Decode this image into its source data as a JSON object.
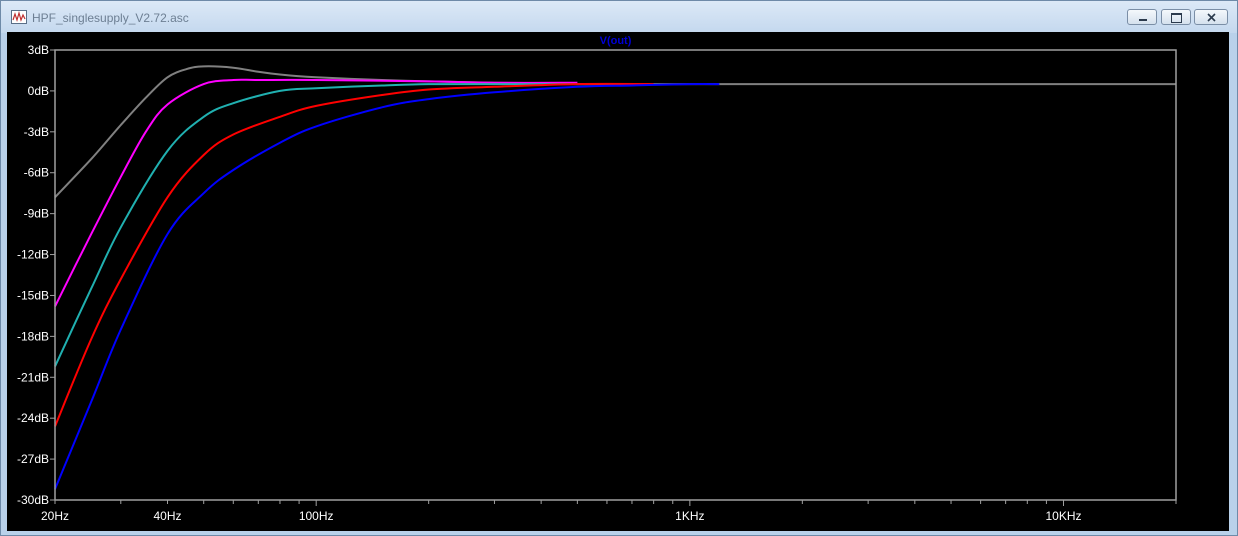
{
  "window": {
    "title": "HPF_singlesupply_V2.72.asc",
    "app_icon": "ltspice-waveform-icon",
    "controls": {
      "minimize": "minimize-icon",
      "maximize": "maximize-icon",
      "close": "close-icon"
    }
  },
  "chart_data": {
    "type": "line",
    "title": "V(out)",
    "title_color": "#0000d8",
    "background": "#000000",
    "axis_color": "#a0a0a0",
    "label_color": "#ffffff",
    "x_scale": "log",
    "xlim": [
      20,
      20000
    ],
    "ylim": [
      -30,
      3
    ],
    "x_ticks": [
      {
        "value": 20,
        "label": "20Hz"
      },
      {
        "value": 40,
        "label": "40Hz"
      },
      {
        "value": 100,
        "label": "100Hz"
      },
      {
        "value": 1000,
        "label": "1KHz"
      },
      {
        "value": 10000,
        "label": "10KHz"
      }
    ],
    "y_ticks": [
      {
        "value": 3,
        "label": "3dB"
      },
      {
        "value": 0,
        "label": "0dB"
      },
      {
        "value": -3,
        "label": "-3dB"
      },
      {
        "value": -6,
        "label": "-6dB"
      },
      {
        "value": -9,
        "label": "-9dB"
      },
      {
        "value": -12,
        "label": "-12dB"
      },
      {
        "value": -15,
        "label": "-15dB"
      },
      {
        "value": -18,
        "label": "-18dB"
      },
      {
        "value": -21,
        "label": "-21dB"
      },
      {
        "value": -24,
        "label": "-24dB"
      },
      {
        "value": -27,
        "label": "-27dB"
      },
      {
        "value": -30,
        "label": "-30dB"
      }
    ],
    "series": [
      {
        "color": "#808080",
        "x": [
          20,
          25,
          30,
          35,
          40,
          45,
          50,
          60,
          70,
          80,
          100,
          150,
          200,
          300,
          500,
          700,
          1000,
          20000
        ],
        "y": [
          -7.8,
          -5,
          -2.5,
          -0.5,
          1,
          1.6,
          1.8,
          1.7,
          1.4,
          1.2,
          1.0,
          0.8,
          0.7,
          0.6,
          0.5,
          0.5,
          0.5,
          0.5
        ]
      },
      {
        "color": "#ff00ff",
        "x": [
          20,
          25,
          30,
          35,
          40,
          50,
          60,
          70,
          100,
          200,
          300,
          500
        ],
        "y": [
          -15.8,
          -10.5,
          -6.3,
          -3,
          -1,
          0.5,
          0.8,
          0.8,
          0.8,
          0.7,
          0.6,
          0.6
        ]
      },
      {
        "color": "#20b0b0",
        "x": [
          20,
          25,
          30,
          40,
          50,
          60,
          80,
          100,
          150,
          200,
          300,
          500,
          700
        ],
        "y": [
          -20.2,
          -14.5,
          -10,
          -4.4,
          -1.9,
          -0.9,
          0,
          0.2,
          0.4,
          0.5,
          0.5,
          0.5,
          0.5
        ]
      },
      {
        "color": "#ff0000",
        "x": [
          20,
          25,
          30,
          40,
          50,
          60,
          80,
          100,
          150,
          200,
          300,
          500,
          800
        ],
        "y": [
          -24.6,
          -18.2,
          -13.8,
          -7.8,
          -4.7,
          -3.2,
          -1.9,
          -1.1,
          -0.3,
          0.1,
          0.3,
          0.5,
          0.5
        ]
      },
      {
        "color": "#0000ff",
        "x": [
          20,
          25,
          30,
          40,
          50,
          60,
          80,
          100,
          150,
          200,
          300,
          500,
          700,
          1000,
          1200
        ],
        "y": [
          -29.2,
          -22.8,
          -17.5,
          -10.5,
          -7.5,
          -5.8,
          -3.8,
          -2.6,
          -1.2,
          -0.6,
          -0.1,
          0.3,
          0.4,
          0.5,
          0.5
        ]
      }
    ]
  }
}
